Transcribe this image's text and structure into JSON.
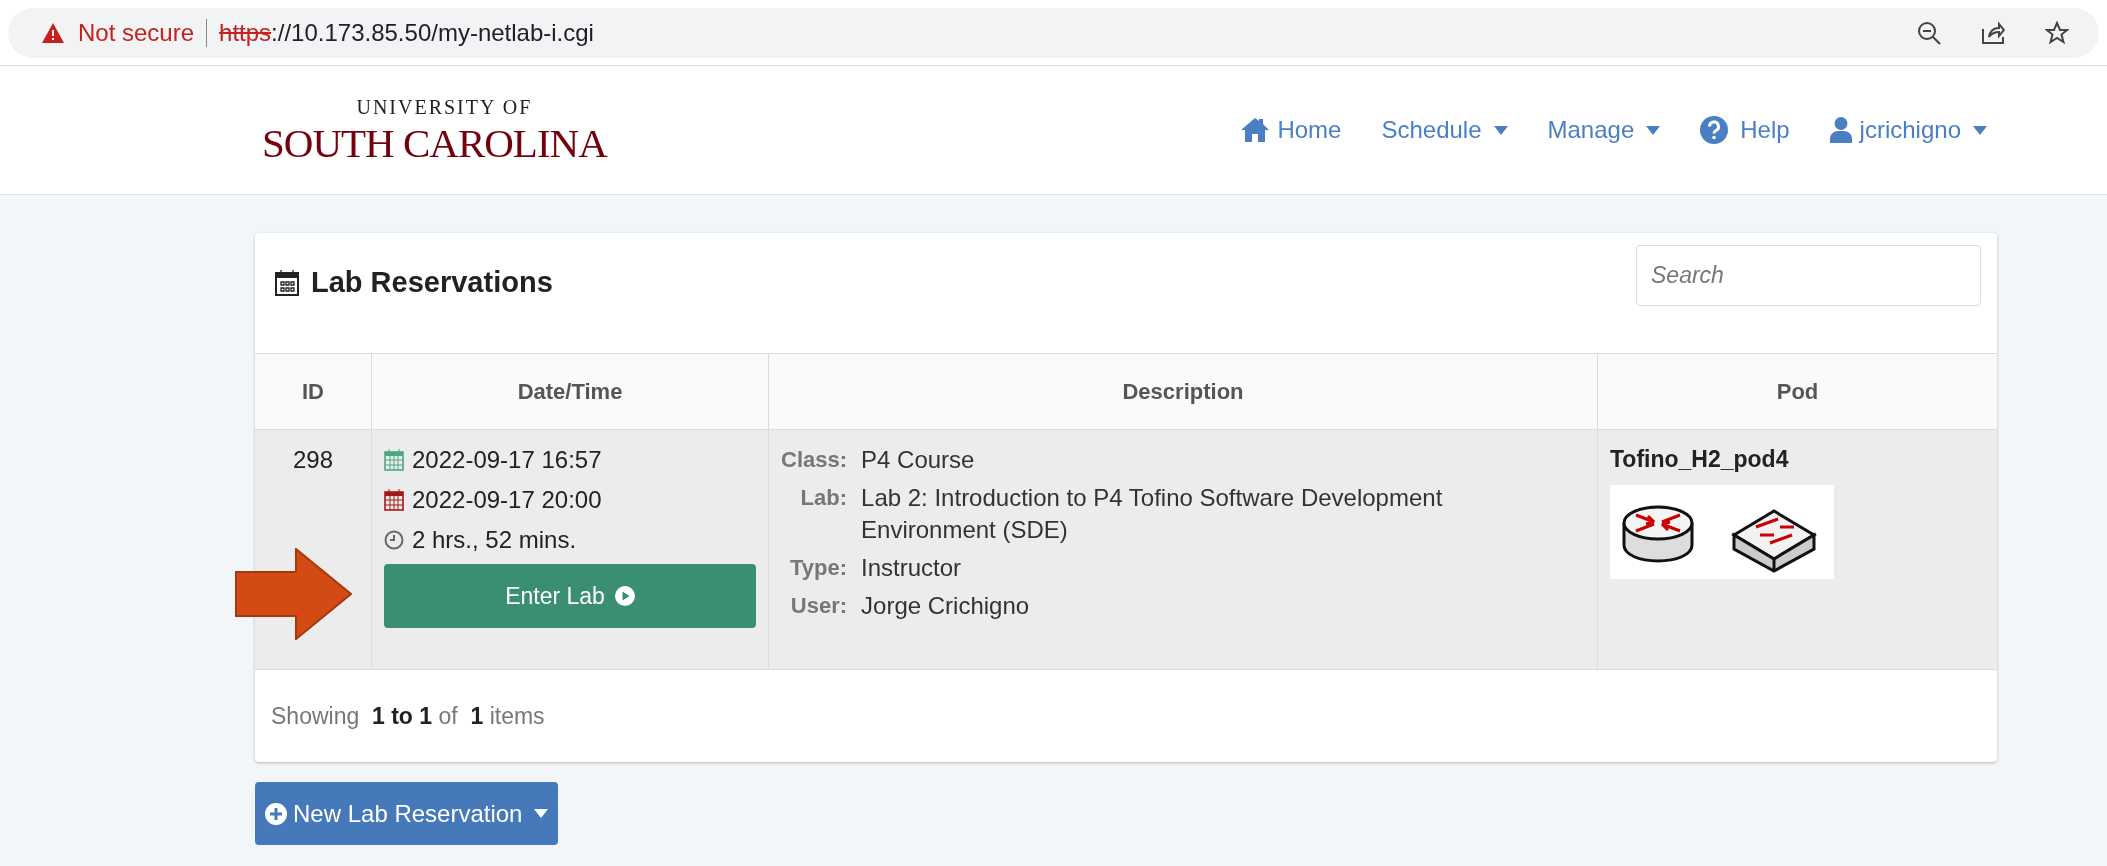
{
  "browser": {
    "security_label": "Not secure",
    "url_scheme": "https",
    "url_rest": "://10.173.85.50/my-netlab-i.cgi"
  },
  "logo": {
    "line_1": "UNIVERSITY OF",
    "line_2": "SOUTH CAROLINA"
  },
  "nav": [
    {
      "label": "Home",
      "kind": "home",
      "dropdown": false
    },
    {
      "label": "Schedule",
      "kind": "plain",
      "dropdown": true
    },
    {
      "label": "Manage",
      "kind": "plain",
      "dropdown": true
    },
    {
      "label": "Help",
      "kind": "help",
      "dropdown": false
    },
    {
      "label": "jcrichigno",
      "kind": "user",
      "dropdown": true
    }
  ],
  "card": {
    "title": "Lab Reservations",
    "search": {
      "placeholder": "Search"
    },
    "columns": [
      "ID",
      "Date/Time",
      "Description",
      "Pod"
    ],
    "rows": [
      {
        "id": "298",
        "start": "2022-09-17 16:57",
        "end": "2022-09-17 20:00",
        "duration": "2 hrs., 52 mins.",
        "action": "Enter Lab",
        "details": [
          {
            "label": "Class:",
            "value": "P4 Course"
          },
          {
            "label": "Lab:",
            "value": "Lab 2: Introduction to P4 Tofino Software Development Environment (SDE)"
          },
          {
            "label": "Type:",
            "value": "Instructor"
          },
          {
            "label": "User:",
            "value": "Jorge Crichigno"
          }
        ],
        "pod": "Tofino_H2_pod4"
      }
    ],
    "footer": "Showing  **1 to 1** of  **1** items"
  },
  "new_button": "New Lab Reservation"
}
